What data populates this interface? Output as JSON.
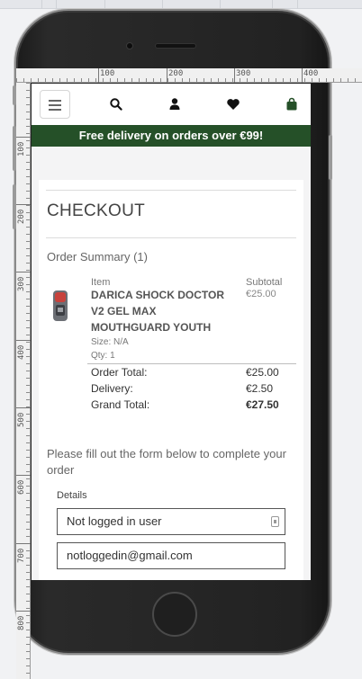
{
  "nav": {
    "icons": [
      "menu-icon",
      "search-icon",
      "user-icon",
      "heart-icon",
      "bag-icon"
    ]
  },
  "banner": {
    "text": "Free delivery on orders over €99!"
  },
  "checkout": {
    "title": "CHECKOUT",
    "order_summary": "Order Summary (1)",
    "columns": {
      "item": "Item",
      "subtotal": "Subtotal"
    },
    "product": {
      "name": "DARICA SHOCK DOCTOR V2 GEL MAX MOUTHGUARD YOUTH",
      "size": "Size: N/A",
      "qty": "Qty: 1",
      "price": "€25.00"
    },
    "totals": {
      "order_total_label": "Order Total:",
      "order_total": "€25.00",
      "delivery_label": "Delivery:",
      "delivery": "€2.50",
      "grand_total_label": "Grand Total:",
      "grand_total": "€27.50"
    },
    "form_intro": "Please fill out the form below to complete your order",
    "details_label": "Details",
    "fields": {
      "name_value": "Not logged in user",
      "email_value": "notloggedin@gmail.com"
    }
  },
  "ruler": {
    "h_labels": [
      "100",
      "200",
      "300",
      "400"
    ],
    "v_labels": [
      "100",
      "200",
      "300",
      "400",
      "500",
      "600",
      "700",
      "800"
    ]
  },
  "colors": {
    "banner_bg": "#255028",
    "bag_icon": "#255028"
  }
}
